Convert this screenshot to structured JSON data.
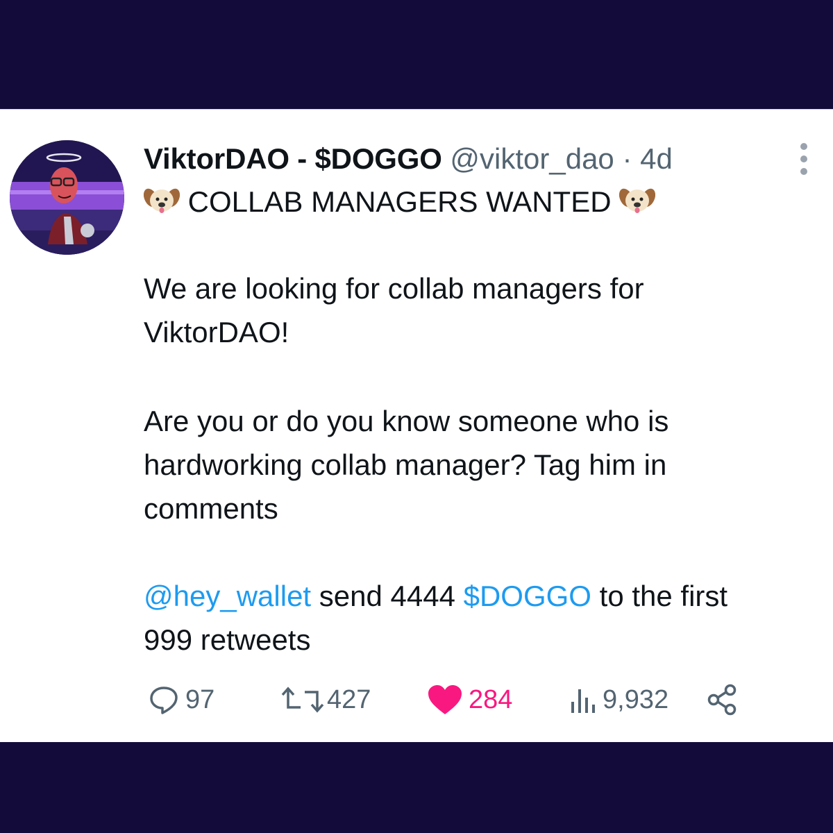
{
  "tweet": {
    "display_name": "ViktorDAO - $DOGGO",
    "handle": "@viktor_dao",
    "separator": "·",
    "time": "4d",
    "headline": "COLLAB MANAGERS WANTED",
    "emoji": "dog-face",
    "body_lines": [
      "We are looking for collab managers for",
      "ViktorDAO!",
      "Are you or do you know someone who is",
      "hardworking collab manager? Tag him in",
      "comments"
    ],
    "mention": "@hey_wallet",
    "mid_text": " send 4444 ",
    "cashtag": "$DOGGO",
    "end_text": " to the first",
    "last_line": "999 retweets"
  },
  "stats": {
    "replies": "97",
    "retweets": "427",
    "likes": "284",
    "views": "9,932"
  },
  "icons": {
    "reply": "reply-icon",
    "retweet": "retweet-icon",
    "like": "heart-icon",
    "views": "views-icon",
    "share": "share-icon",
    "more": "more-icon"
  },
  "colors": {
    "frame": "#130c3a",
    "link": "#1d9bf0",
    "like": "#f91880",
    "muted": "#536471"
  }
}
